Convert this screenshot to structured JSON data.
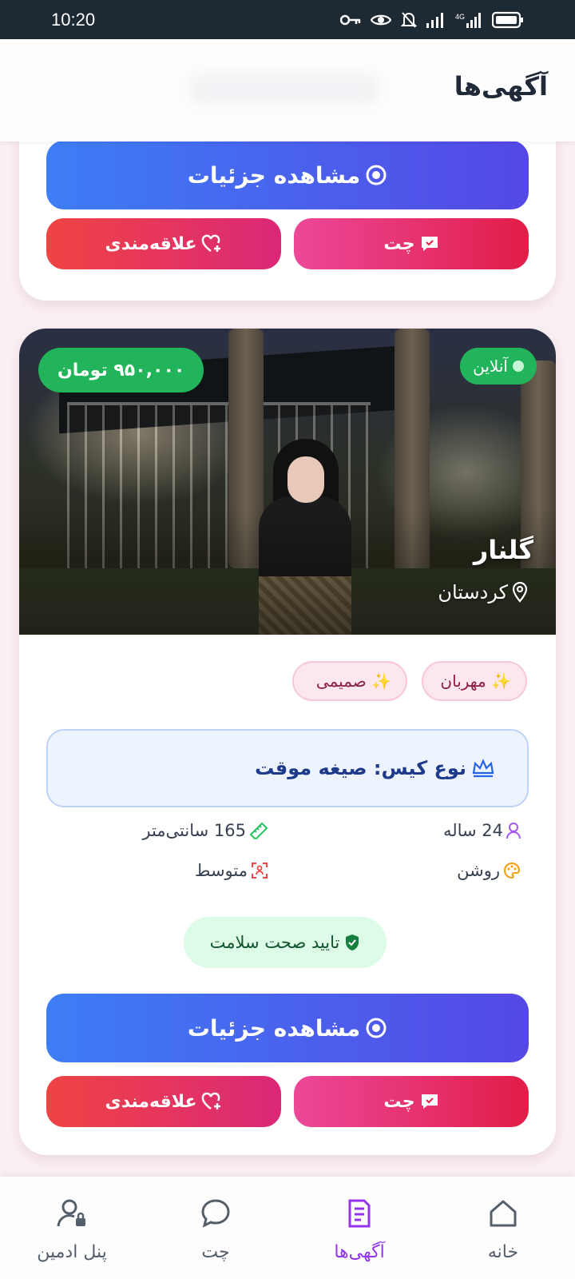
{
  "status_bar": {
    "time": "10:20"
  },
  "header": {
    "title": "آگهی‌ها"
  },
  "top_card": {
    "details_label": "مشاهده جزئیات",
    "chat_label": "چت",
    "favorite_label": "علاقه‌مندی"
  },
  "listing": {
    "price": "۹۵۰,۰۰۰ تومان",
    "online_label": "آنلاین",
    "name": "گلنار",
    "location": "کردستان",
    "tags": [
      "✨ مهربان",
      "✨ صمیمی"
    ],
    "case_type": "نوع کیس: صیغه موقت",
    "age": "24 ساله",
    "height": "165 سانتی‌متر",
    "skin": "روشن",
    "body": "متوسط",
    "health": "تایید صحت سلامت",
    "details_label": "مشاهده جزئیات",
    "chat_label": "چت",
    "favorite_label": "علاقه‌مندی"
  },
  "bottom_nav": [
    {
      "label": "پنل ادمین",
      "icon": "admin-user-icon",
      "active": false
    },
    {
      "label": "چت",
      "icon": "chat-icon",
      "active": false
    },
    {
      "label": "آگهی‌ها",
      "icon": "listings-icon",
      "active": true
    },
    {
      "label": "خانه",
      "icon": "home-icon",
      "active": false
    }
  ],
  "colors": {
    "primary_gradient": [
      "#3d7ef5",
      "#5548e6"
    ],
    "chat_gradient": [
      "#ec4899",
      "#e11d48"
    ],
    "favorite_gradient": [
      "#ef4444",
      "#db2777"
    ],
    "success": "#22b45a",
    "active_nav": "#9333ea"
  }
}
